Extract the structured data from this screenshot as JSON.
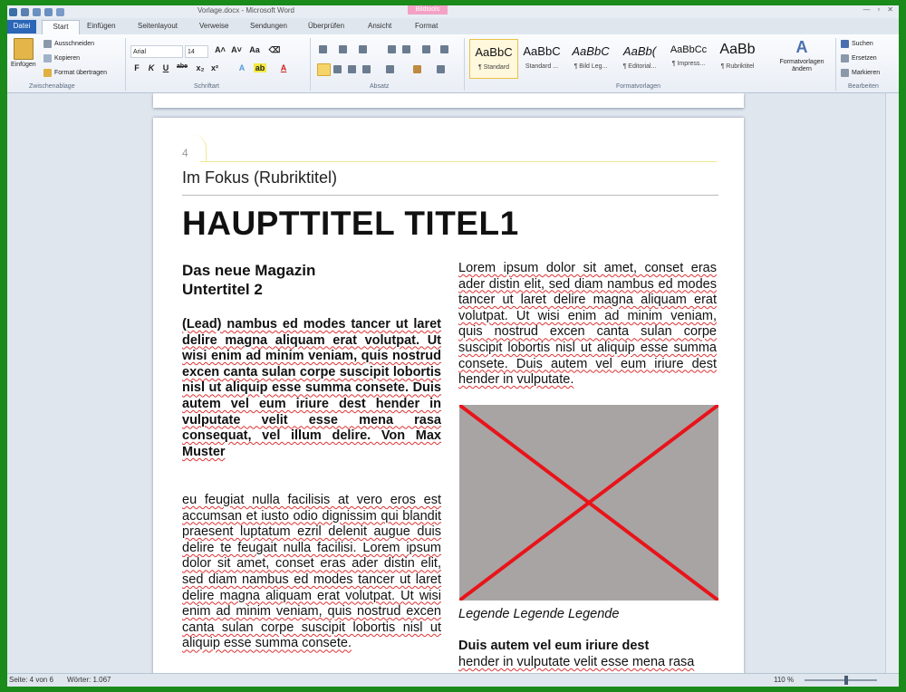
{
  "window": {
    "title": "Vorlage.docx - Microsoft Word",
    "contextual_tab": "Bildtools",
    "controls": [
      "—",
      "▫",
      "✕"
    ]
  },
  "tabs": [
    {
      "label": "Datei"
    },
    {
      "label": "Start"
    },
    {
      "label": "Einfügen"
    },
    {
      "label": "Seitenlayout"
    },
    {
      "label": "Verweise"
    },
    {
      "label": "Sendungen"
    },
    {
      "label": "Überprüfen"
    },
    {
      "label": "Ansicht"
    },
    {
      "label": "Format"
    }
  ],
  "ribbon": {
    "clipboard": {
      "paste": "Einfügen",
      "cut": "Ausschneiden",
      "copy": "Kopieren",
      "format_painter": "Format übertragen",
      "label": "Zwischenablage"
    },
    "font": {
      "name": "Arial",
      "size": "14",
      "label": "Schriftart",
      "buttons": [
        "F",
        "K",
        "U",
        "abe",
        "x₂",
        "x²",
        "A",
        "ab",
        "A"
      ],
      "grow_shrink": [
        "A˄",
        "A˅",
        "Aa",
        "⌫"
      ]
    },
    "paragraph": {
      "label": "Absatz"
    },
    "styles": {
      "label": "Formatvorlagen",
      "items": [
        {
          "sample": "AaBbC",
          "name": "¶ Standard"
        },
        {
          "sample": "AaBbC",
          "name": "Standard ..."
        },
        {
          "sample": "AaBbC",
          "name": "¶ Bild Leg..."
        },
        {
          "sample": "AaBb(",
          "name": "¶ Editorial..."
        },
        {
          "sample": "AaBbCc",
          "name": "¶ Impress..."
        },
        {
          "sample": "AaBb",
          "name": "¶ Rubriktitel"
        }
      ],
      "change": "Formatvorlagen ändern"
    },
    "editing": {
      "label": "Bearbeiten",
      "search": "Suchen",
      "replace": "Ersetzen",
      "select": "Markieren"
    }
  },
  "document": {
    "page_number": "4",
    "rubrik": "Im Fokus (Rubriktitel)",
    "main_title": "HAUPTTITEL TITEL1",
    "subtitle_line1": "Das neue Magazin",
    "subtitle_line2": "Untertitel 2",
    "lead": "(Lead) nambus ed modes tancer ut laret delire magna aliquam erat volutpat. Ut wisi enim ad minim veniam, quis nostrud excen canta sulan corpe suscipit lobortis nisl ut aliquip esse summa consete. Duis autem vel eum iriure dest hender in vulputate velit esse mena rasa consequat, vel illum delire. Von Max Muster",
    "body_left": "eu feugiat nulla facilisis at vero eros est accumsan et iusto odio dignissim qui blandit praesent luptatum ezril delenit augue duis delire te feugait nulla facilisi. Lorem ipsum dolor sit amet, conset eras ader distin elit, sed diam nambus ed modes tancer ut laret delire magna aliquam erat volutpat. Ut wisi enim ad minim veniam, quis nostrud excen canta sulan corpe suscipit lobortis nisl ut aliquip esse summa consete.",
    "body_right": "Lorem ipsum dolor sit amet, conset eras ader distin elit, sed diam nambus ed modes tancer ut laret delire magna aliquam erat volutpat. Ut wisi enim ad minim veniam, quis nostrud excen canta sulan corpe suscipit lobortis nisl ut aliquip esse summa consete. Duis autem vel eum iriure dest hender in vulputate.",
    "caption": "Legende Legende Legende",
    "subhead": "Duis autem vel eum iriure dest",
    "body_right_2": "hender in vulputate velit esse mena rasa"
  },
  "status": {
    "page": "Seite: 4 von 6",
    "words": "Wörter: 1.067",
    "zoom": "110 %"
  },
  "colors": {
    "accent": "#2b66b8",
    "outer_border": "#1a8a1a",
    "placeholder_x": "#e8141a"
  }
}
